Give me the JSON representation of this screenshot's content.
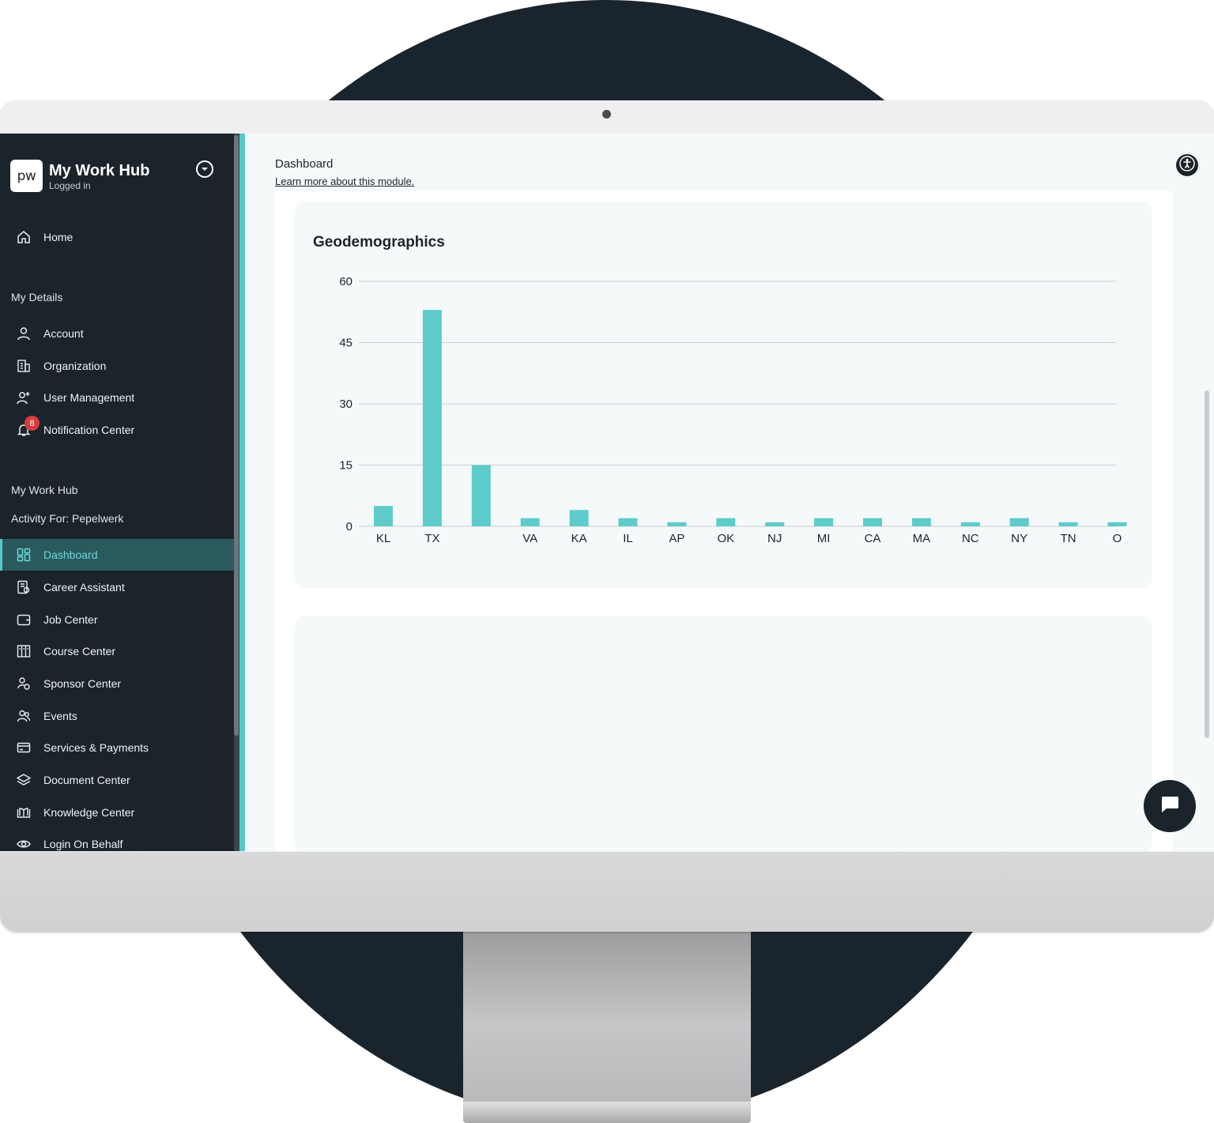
{
  "sidebar": {
    "logo_text": "pw",
    "app_title": "My Work Hub",
    "status": "Logged in",
    "home_label": "Home",
    "section_my_details": "My Details",
    "details_items": [
      {
        "label": "Account",
        "icon": "user-icon"
      },
      {
        "label": "Organization",
        "icon": "building-icon"
      },
      {
        "label": "User Management",
        "icon": "user-plus-icon"
      },
      {
        "label": "Notification Center",
        "icon": "bell-icon"
      }
    ],
    "notification_count": "8",
    "section_work_hub": "My Work Hub",
    "activity_for": "Activity For: Pepelwerk",
    "hub_items": [
      {
        "label": "Dashboard",
        "icon": "dashboard-icon",
        "active": true
      },
      {
        "label": "Career Assistant",
        "icon": "career-icon"
      },
      {
        "label": "Job Center",
        "icon": "wallet-icon"
      },
      {
        "label": "Course Center",
        "icon": "books-icon"
      },
      {
        "label": "Sponsor Center",
        "icon": "sponsor-icon"
      },
      {
        "label": "Events",
        "icon": "people-icon"
      },
      {
        "label": "Services & Payments",
        "icon": "card-icon"
      },
      {
        "label": "Document Center",
        "icon": "layers-icon"
      },
      {
        "label": "Knowledge Center",
        "icon": "book-open-icon"
      },
      {
        "label": "Login On Behalf",
        "icon": "eye-icon"
      }
    ]
  },
  "header": {
    "title": "Dashboard",
    "learn_more": "Learn more about this module."
  },
  "colors": {
    "sidebar_bg": "#1b242b",
    "accent": "#56c8c8",
    "bar": "#5ecbcb",
    "badge": "#d93c3c"
  },
  "chart_data": {
    "type": "bar",
    "title": "Geodemographics",
    "categories": [
      "KL",
      "TX",
      "",
      "VA",
      "KA",
      "IL",
      "AP",
      "OK",
      "NJ",
      "MI",
      "CA",
      "MA",
      "NC",
      "NY",
      "TN",
      "O"
    ],
    "values": [
      5,
      53,
      15,
      2,
      4,
      2,
      1,
      2,
      1,
      2,
      2,
      2,
      1,
      2,
      1,
      1
    ],
    "yticks": [
      0,
      15,
      30,
      45,
      60
    ],
    "ylim": [
      0,
      60
    ],
    "grid": true,
    "xlabel": "",
    "ylabel": ""
  }
}
